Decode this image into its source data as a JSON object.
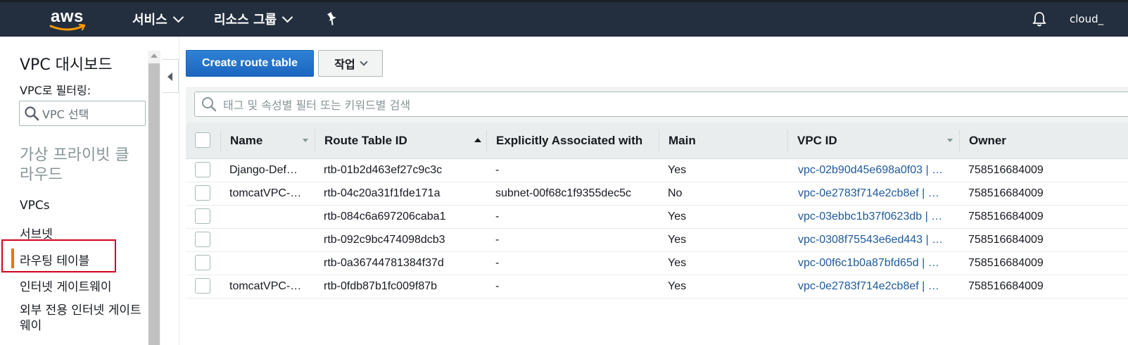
{
  "topnav": {
    "logo_text": "aws",
    "services_label": "서비스",
    "resource_groups_label": "리소스 그룹",
    "pin_icon": "pin-icon",
    "bell_icon": "bell-icon",
    "user_label": "cloud_"
  },
  "sidebar": {
    "title": "VPC 대시보드",
    "filter_label": "VPC로 필터링:",
    "vpc_select_placeholder": "VPC 선택",
    "section_title": "가상 프라이빗 클라우드",
    "items": [
      {
        "label": "VPCs"
      },
      {
        "label": "서브넷"
      },
      {
        "label": "라우팅 테이블",
        "active": true
      },
      {
        "label": "인터넷 게이트웨이"
      },
      {
        "label": "외부 전용 인터넷 게이트웨이"
      }
    ]
  },
  "toolbar": {
    "create_label": "Create route table",
    "actions_label": "작업"
  },
  "search": {
    "placeholder": "태그 및 속성별 필터 또는 키워드별 검색"
  },
  "table": {
    "columns": [
      "Name",
      "Route Table ID",
      "Explicitly Associated with",
      "Main",
      "VPC ID",
      "Owner"
    ],
    "rows": [
      {
        "name": "Django-Def…",
        "id": "rtb-01b2d463ef27c9c3c",
        "assoc": "-",
        "main": "Yes",
        "vpc": "vpc-02b90d45e698a0f03 | …",
        "owner": "758516684009"
      },
      {
        "name": "tomcatVPC-…",
        "id": "rtb-04c20a31f1fde171a",
        "assoc": "subnet-00f68c1f9355dec5c",
        "main": "No",
        "vpc": "vpc-0e2783f714e2cb8ef | …",
        "owner": "758516684009"
      },
      {
        "name": "",
        "id": "rtb-084c6a697206caba1",
        "assoc": "-",
        "main": "Yes",
        "vpc": "vpc-03ebbc1b37f0623db | …",
        "owner": "758516684009"
      },
      {
        "name": "",
        "id": "rtb-092c9bc474098dcb3",
        "assoc": "-",
        "main": "Yes",
        "vpc": "vpc-0308f75543e6ed443 | …",
        "owner": "758516684009"
      },
      {
        "name": "",
        "id": "rtb-0a36744781384f37d",
        "assoc": "-",
        "main": "Yes",
        "vpc": "vpc-00f6c1b0a87bfd65d | …",
        "owner": "758516684009"
      },
      {
        "name": "tomcatVPC-…",
        "id": "rtb-0fdb87b1fc009f87b",
        "assoc": "-",
        "main": "Yes",
        "vpc": "vpc-0e2783f714e2cb8ef | …",
        "owner": "758516684009"
      }
    ]
  },
  "colors": {
    "nav_bg": "#232f3e",
    "primary": "#1b66c0",
    "link": "#1d5a9b",
    "active_bar": "#ec7211",
    "highlight_box": "#d0021b"
  }
}
